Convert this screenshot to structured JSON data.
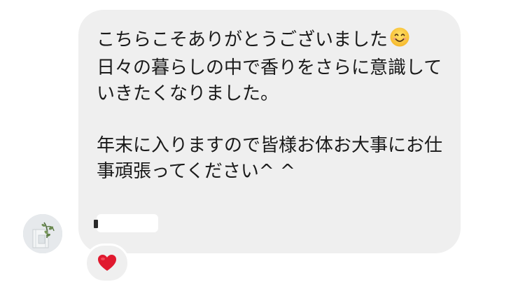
{
  "message": {
    "lines": [
      "こちらこそありがとうございました",
      "日々の暮らしの中で香りをさらに意識して",
      "いきたくなりました。",
      "",
      "年末に入りますので皆様お体お大事にお仕",
      "事頑張ってください^ ^"
    ],
    "emoji_icon": "smiling-face-emoji"
  },
  "sender": {
    "avatar_icon": "plant-photo-avatar"
  },
  "reaction": {
    "icon": "red-heart-icon",
    "color": "#e0192e"
  }
}
